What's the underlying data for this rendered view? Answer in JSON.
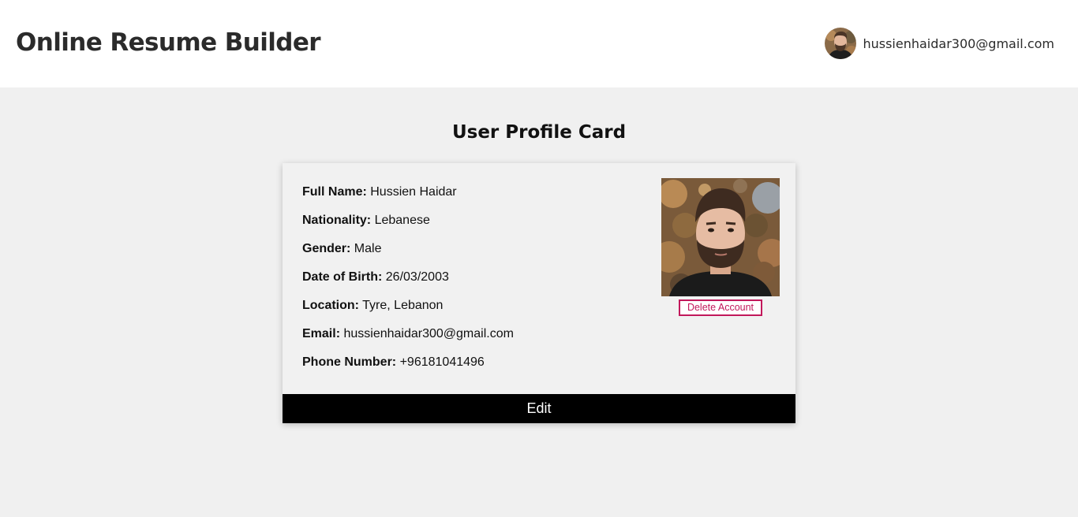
{
  "header": {
    "brand": "Online Resume Builder",
    "user_email": "hussienhaidar300@gmail.com"
  },
  "main": {
    "title": "User Profile Card"
  },
  "profile": {
    "fields": [
      {
        "label": "Full Name:",
        "value": "Hussien Haidar"
      },
      {
        "label": "Nationality:",
        "value": "Lebanese"
      },
      {
        "label": "Gender:",
        "value": "Male"
      },
      {
        "label": "Date of Birth:",
        "value": "26/03/2003"
      },
      {
        "label": "Location:",
        "value": "Tyre, Lebanon"
      },
      {
        "label": "Email:",
        "value": "hussienhaidar300@gmail.com"
      },
      {
        "label": "Phone Number:",
        "value": "+96181041496"
      }
    ],
    "delete_label": "Delete Account",
    "edit_label": "Edit"
  },
  "colors": {
    "header_bg": "#ffffff",
    "page_bg": "#f0f0f0",
    "danger": "#c2185b",
    "edit_bg": "#000000"
  }
}
